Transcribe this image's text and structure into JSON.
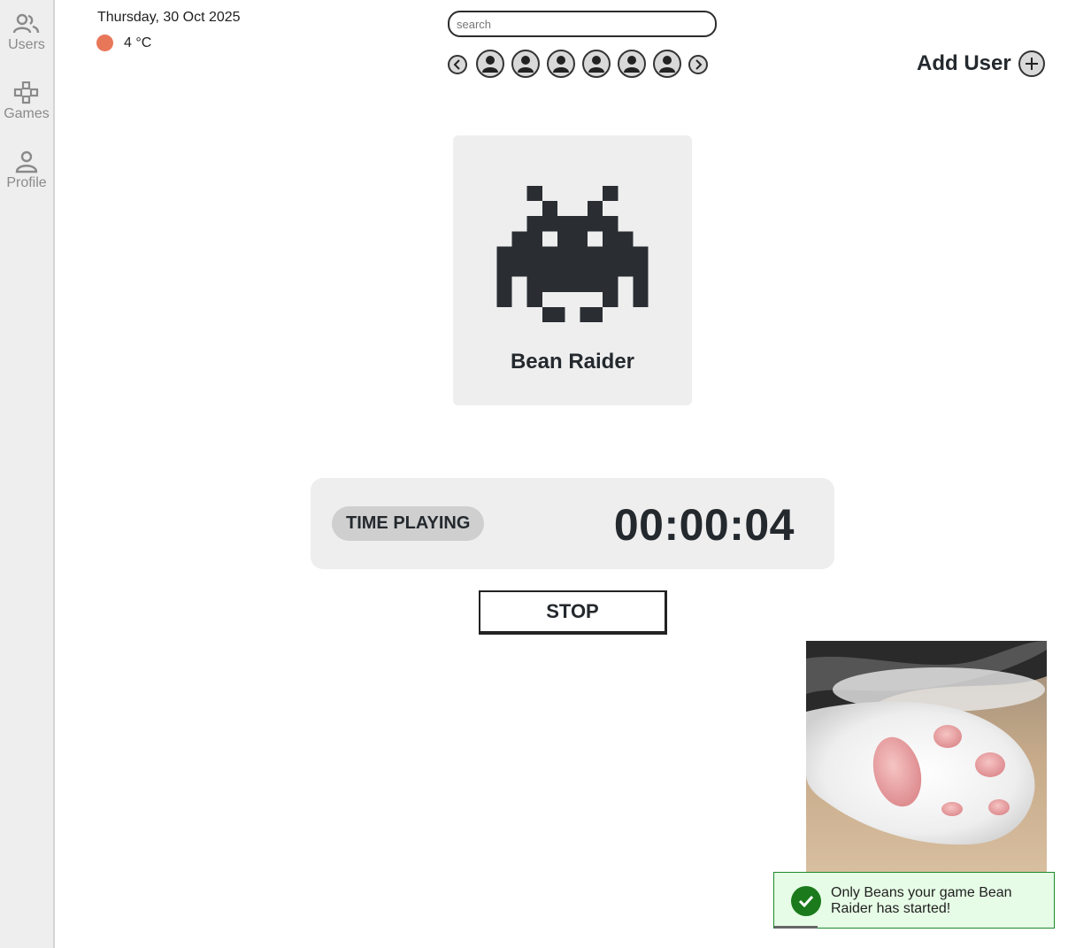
{
  "sidebar": {
    "items": [
      {
        "label": "Users",
        "icon": "users-icon"
      },
      {
        "label": "Games",
        "icon": "gamepad-icon"
      },
      {
        "label": "Profile",
        "icon": "person-icon"
      }
    ]
  },
  "header": {
    "date": "Thursday, 30 Oct 2025",
    "weather": {
      "temperature": "4 °C",
      "indicator_color": "#e8775a"
    },
    "search": {
      "placeholder": "search",
      "value": ""
    },
    "add_user_label": "Add User"
  },
  "user_carousel": {
    "avatar_count": 6,
    "prev_icon": "chevron-left-icon",
    "next_icon": "chevron-right-icon"
  },
  "game": {
    "title": "Bean Raider",
    "icon": "space-invader-icon"
  },
  "timer": {
    "label": "TIME PLAYING",
    "value": "00:00:04"
  },
  "stop_label": "STOP",
  "toast": {
    "message": "Only Beans your game Bean Raider has started!",
    "status": "success",
    "color": "#1b7a1b"
  },
  "photo": {
    "subject": "cat paw"
  }
}
